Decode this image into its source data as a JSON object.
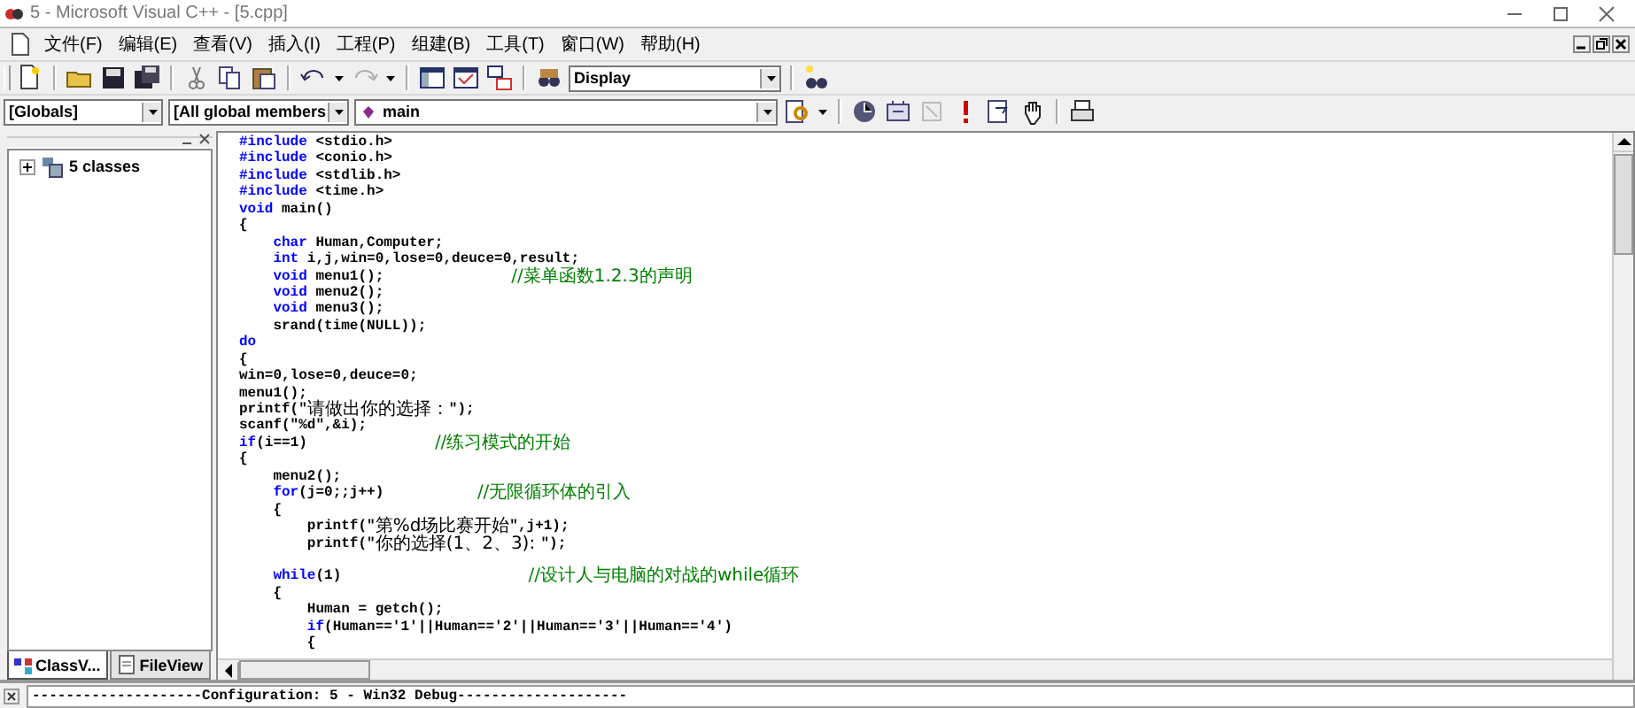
{
  "window": {
    "title": "5 - Microsoft Visual C++ - [5.cpp]"
  },
  "menu": [
    "文件(F)",
    "编辑(E)",
    "查看(V)",
    "插入(I)",
    "工程(P)",
    "组建(B)",
    "工具(T)",
    "窗口(W)",
    "帮助(H)"
  ],
  "find_combo": {
    "value": "Display"
  },
  "wizard_bar": {
    "scope": "[Globals]",
    "filter": "[All global members",
    "member": "main"
  },
  "workspace": {
    "tree": [
      {
        "label": "5 classes",
        "expanded": false
      }
    ],
    "tabs": [
      {
        "label": "ClassV...",
        "selected": true
      },
      {
        "label": "FileView",
        "selected": false
      }
    ]
  },
  "editor": {
    "lines": [
      {
        "kind": "code",
        "segments": [
          {
            "kind": "keyword",
            "text": "#include"
          },
          {
            "kind": "text",
            "text": " <stdio.h>"
          }
        ]
      },
      {
        "kind": "code",
        "segments": [
          {
            "kind": "keyword",
            "text": "#include"
          },
          {
            "kind": "text",
            "text": " <conio.h>"
          }
        ]
      },
      {
        "kind": "code",
        "segments": [
          {
            "kind": "keyword",
            "text": "#include"
          },
          {
            "kind": "text",
            "text": " <stdlib.h>"
          }
        ]
      },
      {
        "kind": "code",
        "segments": [
          {
            "kind": "keyword",
            "text": "#include"
          },
          {
            "kind": "text",
            "text": " <time.h>"
          }
        ]
      },
      {
        "kind": "code",
        "segments": [
          {
            "kind": "keyword",
            "text": "void"
          },
          {
            "kind": "text",
            "text": " main()"
          }
        ]
      },
      {
        "kind": "code",
        "segments": [
          {
            "kind": "text",
            "text": "{"
          }
        ]
      },
      {
        "kind": "code",
        "segments": [
          {
            "kind": "keyword",
            "text": "    char"
          },
          {
            "kind": "text",
            "text": " Human,Computer;"
          }
        ]
      },
      {
        "kind": "code",
        "segments": [
          {
            "kind": "keyword",
            "text": "    int"
          },
          {
            "kind": "text",
            "text": " i,j,win=0,lose=0,deuce=0,result;"
          }
        ]
      },
      {
        "kind": "code",
        "segments": [
          {
            "kind": "keyword",
            "text": "    void"
          },
          {
            "kind": "text",
            "text": " menu1();               "
          },
          {
            "kind": "comment",
            "text": "//菜单函数1.2.3的声明"
          }
        ]
      },
      {
        "kind": "code",
        "segments": [
          {
            "kind": "keyword",
            "text": "    void"
          },
          {
            "kind": "text",
            "text": " menu2();"
          }
        ]
      },
      {
        "kind": "code",
        "segments": [
          {
            "kind": "keyword",
            "text": "    void"
          },
          {
            "kind": "text",
            "text": " menu3();"
          }
        ]
      },
      {
        "kind": "code",
        "segments": [
          {
            "kind": "text",
            "text": "    srand(time(NULL));"
          }
        ]
      },
      {
        "kind": "code",
        "segments": [
          {
            "kind": "keyword",
            "text": "do"
          }
        ]
      },
      {
        "kind": "code",
        "segments": [
          {
            "kind": "text",
            "text": "{"
          }
        ]
      },
      {
        "kind": "code",
        "segments": [
          {
            "kind": "text",
            "text": "win=0,lose=0,deuce=0;"
          }
        ]
      },
      {
        "kind": "code",
        "segments": [
          {
            "kind": "text",
            "text": "menu1();"
          }
        ]
      },
      {
        "kind": "code",
        "segments": [
          {
            "kind": "text",
            "text": "printf(\""
          },
          {
            "kind": "string",
            "text": "请做出你的选择："
          },
          {
            "kind": "text",
            "text": "\");"
          }
        ]
      },
      {
        "kind": "code",
        "segments": [
          {
            "kind": "text",
            "text": "scanf(\"%d\",&i);"
          }
        ]
      },
      {
        "kind": "code",
        "segments": [
          {
            "kind": "keyword",
            "text": "if"
          },
          {
            "kind": "text",
            "text": "(i==1)               "
          },
          {
            "kind": "comment",
            "text": "//练习模式的开始"
          }
        ]
      },
      {
        "kind": "code",
        "segments": [
          {
            "kind": "text",
            "text": "{"
          }
        ]
      },
      {
        "kind": "code",
        "segments": [
          {
            "kind": "text",
            "text": "    menu2();"
          }
        ]
      },
      {
        "kind": "code",
        "segments": [
          {
            "kind": "keyword",
            "text": "    for"
          },
          {
            "kind": "text",
            "text": "(j=0;;j++)           "
          },
          {
            "kind": "comment",
            "text": "//无限循环体的引入"
          }
        ]
      },
      {
        "kind": "code",
        "segments": [
          {
            "kind": "text",
            "text": "    {"
          }
        ]
      },
      {
        "kind": "code",
        "segments": [
          {
            "kind": "text",
            "text": "        printf(\""
          },
          {
            "kind": "string",
            "text": "第%d场比赛开始"
          },
          {
            "kind": "text",
            "text": "\",j+1);"
          }
        ]
      },
      {
        "kind": "code",
        "segments": [
          {
            "kind": "text",
            "text": "        printf(\""
          },
          {
            "kind": "string",
            "text": "你的选择(1、2、3): "
          },
          {
            "kind": "text",
            "text": "\");"
          }
        ]
      },
      {
        "kind": "blank"
      },
      {
        "kind": "code",
        "segments": [
          {
            "kind": "keyword",
            "text": "    while"
          },
          {
            "kind": "text",
            "text": "(1)                      "
          },
          {
            "kind": "comment",
            "text": "//设计人与电脑的对战的while循环"
          }
        ]
      },
      {
        "kind": "code",
        "segments": [
          {
            "kind": "text",
            "text": "    {"
          }
        ]
      },
      {
        "kind": "code",
        "segments": [
          {
            "kind": "text",
            "text": "        Human = getch();"
          }
        ]
      },
      {
        "kind": "code",
        "segments": [
          {
            "kind": "keyword",
            "text": "        if"
          },
          {
            "kind": "text",
            "text": "(Human=='1'||Human=='2'||Human=='3'||Human=='4')"
          }
        ]
      },
      {
        "kind": "code",
        "segments": [
          {
            "kind": "text",
            "text": "        {"
          }
        ]
      }
    ]
  },
  "output": {
    "text": "--------------------Configuration: 5 - Win32 Debug--------------------"
  }
}
